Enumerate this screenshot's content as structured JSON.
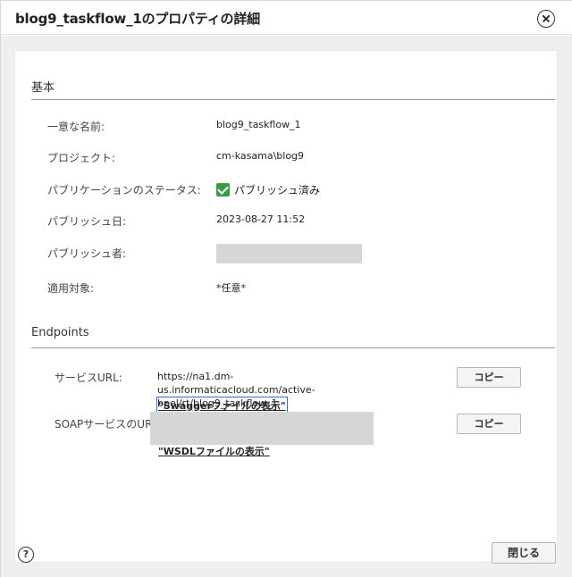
{
  "dialog": {
    "title": "blog9_taskflow_1のプロパティの詳細",
    "close_icon": "close-circle-icon",
    "help_icon_text": "?",
    "close_button_label": "閉じる"
  },
  "basic": {
    "section_title": "基本",
    "unique_name_label": "一意な名前:",
    "unique_name_value": "blog9_taskflow_1",
    "project_label": "プロジェクト:",
    "project_value": "cm-kasama\\blog9",
    "publication_status_label": "パブリケーションのステータス:",
    "publication_status_value": "パブリッシュ済み",
    "publication_status_icon": "checkbox-checked-icon",
    "published_date_label": "パブリッシュ日:",
    "published_date_value": "2023-08-27 11:52",
    "publisher_label": "パブリッシュ者:",
    "applies_to_label": "適用対象:",
    "applies_to_value": "*任意*"
  },
  "endpoints": {
    "section_title": "Endpoints",
    "service_url_label": "サービスURL:",
    "service_url_value": "https://na1.dm-us.informaticacloud.com/active-bpel/rt/blog9_taskflow_1",
    "swagger_link": "\"Swaggerファイルの表示\"",
    "copy_button_label": "コピー",
    "soap_url_label": "SOAPサービスのURL:",
    "wsdl_link": "\"WSDLファイルの表示\"",
    "copy_button_label_2": "コピー"
  },
  "colors": {
    "check_green": "#3c9a45",
    "focus_blue": "#2f6fd0",
    "body_bg": "#efefef"
  }
}
